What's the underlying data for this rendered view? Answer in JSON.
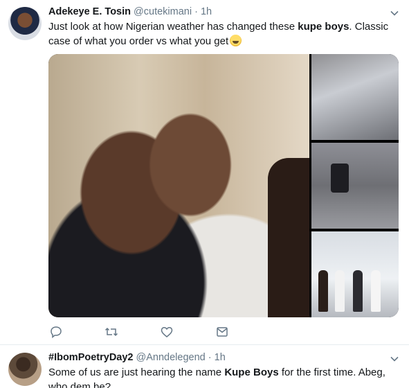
{
  "tweet1": {
    "name": "Adekeye E. Tosin",
    "handle": "@cutekimani",
    "separator": "·",
    "time": "1h",
    "text_part1": "Just look at how Nigerian weather has changed these ",
    "text_bold": "kupe boys",
    "text_part2": ". Classic case of what you order vs what you get",
    "emoji": "weary-face",
    "actions": [
      "reply-icon",
      "retweet-icon",
      "like-icon",
      "direct-message-icon"
    ]
  },
  "tweet2": {
    "name": "#IbomPoetryDay2",
    "handle": "@Anndelegend",
    "separator": "·",
    "time": "1h",
    "text_part1": "Some of us are just hearing the name ",
    "text_bold": "Kupe Boys",
    "text_part2": " for the first time. Abeg, who dem be?"
  },
  "colors": {
    "text": "#14171a",
    "secondary": "#657786",
    "divider": "#e6ecf0",
    "icon": "#657786"
  }
}
